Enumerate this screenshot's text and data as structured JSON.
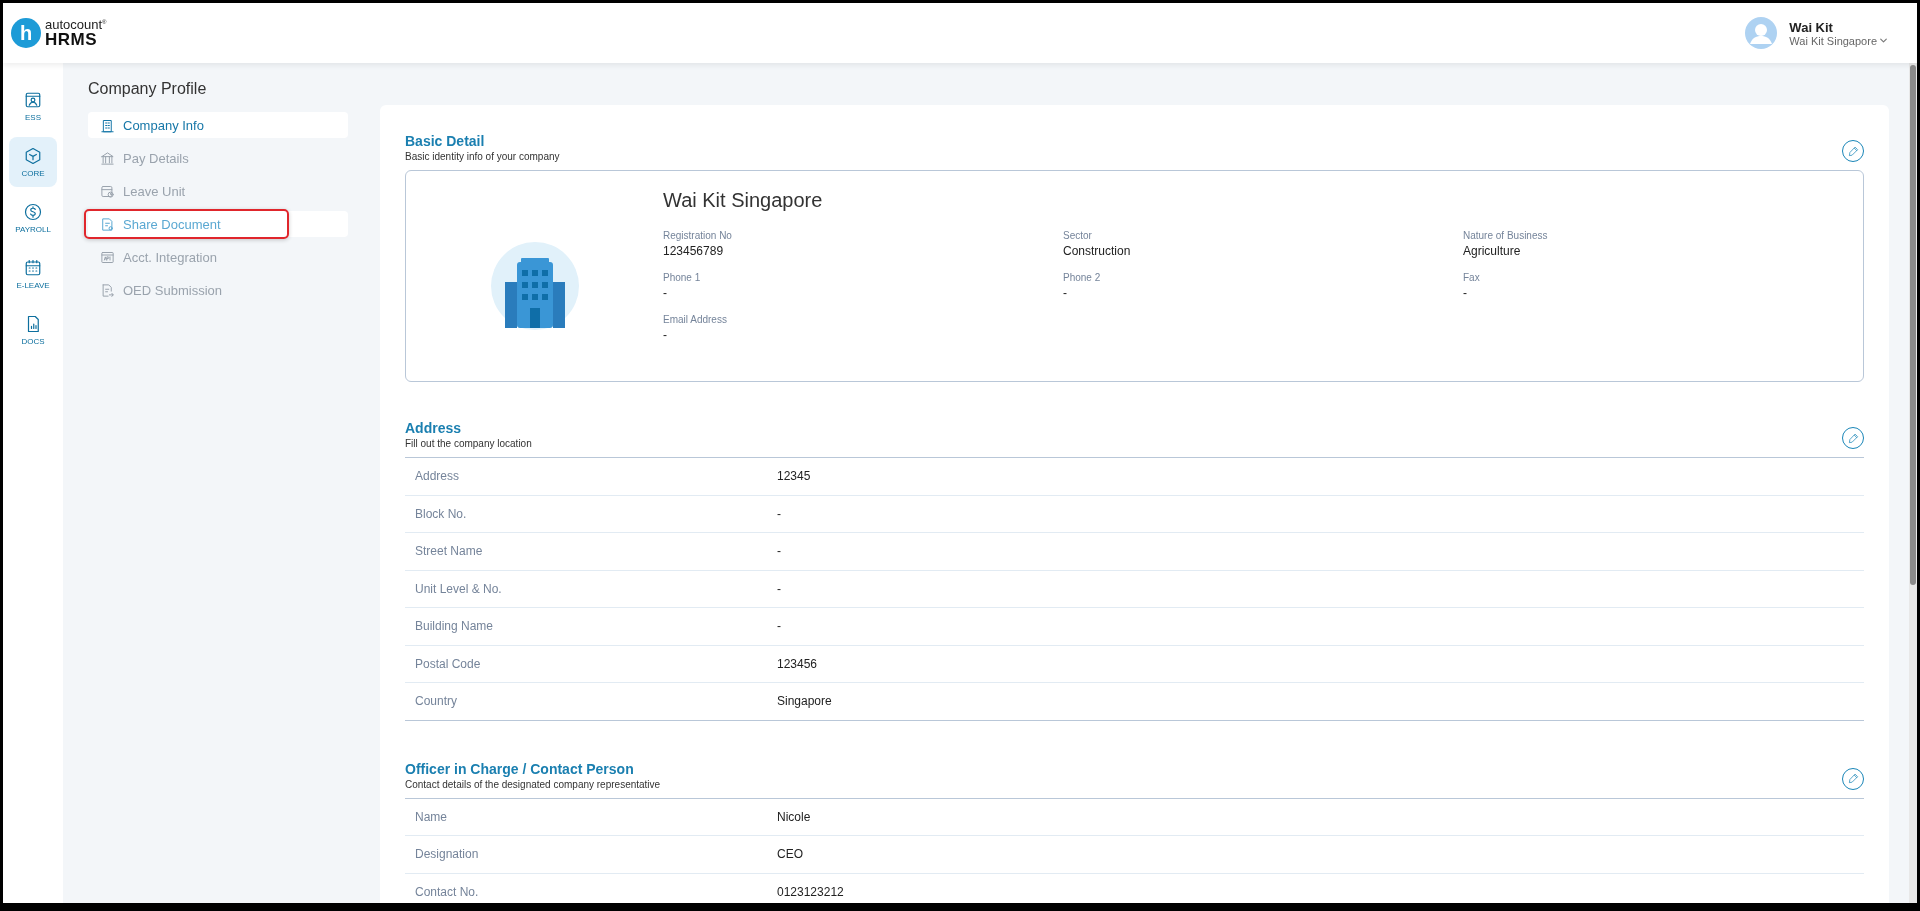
{
  "header": {
    "logo": {
      "mark": "h",
      "brand": "autocount$^{®}$",
      "product": "HRMS"
    },
    "user": {
      "name": "Wai Kit",
      "company": "Wai Kit Singapore"
    }
  },
  "rail": [
    {
      "label": "ESS",
      "kind": "ess",
      "selected": false
    },
    {
      "label": "CORE",
      "kind": "core",
      "selected": true
    },
    {
      "label": "PAYROLL",
      "kind": "payroll",
      "selected": false
    },
    {
      "label": "E-LEAVE",
      "kind": "leave",
      "selected": false
    },
    {
      "label": "DOCS",
      "kind": "docs",
      "selected": false
    }
  ],
  "page_title": "Company Profile",
  "nav": [
    {
      "label": "Company Info",
      "kind": "building",
      "selected": true,
      "highlighted": false
    },
    {
      "label": "Pay Details",
      "kind": "bank",
      "selected": false,
      "highlighted": false
    },
    {
      "label": "Leave Unit",
      "kind": "calendar",
      "selected": false,
      "highlighted": false
    },
    {
      "label": "Share Document",
      "kind": "document",
      "selected": false,
      "highlighted": true
    },
    {
      "label": "Acct. Integration",
      "kind": "api",
      "selected": false,
      "highlighted": false
    },
    {
      "label": "OED Submission",
      "kind": "submit",
      "selected": false,
      "highlighted": false
    }
  ],
  "basic_detail": {
    "title": "Basic Detail",
    "subtitle": "Basic identity info of your company",
    "company_name": "Wai Kit Singapore",
    "fields": [
      {
        "label": "Registration No",
        "value": "123456789"
      },
      {
        "label": "Sector",
        "value": "Construction"
      },
      {
        "label": "Nature of Business",
        "value": "Agriculture"
      },
      {
        "label": "Phone 1",
        "value": "-"
      },
      {
        "label": "Phone 2",
        "value": "-"
      },
      {
        "label": "Fax",
        "value": "-"
      },
      {
        "label": "Email Address",
        "value": "-"
      }
    ]
  },
  "address": {
    "title": "Address",
    "subtitle": "Fill out the company location",
    "rows": [
      {
        "label": "Address",
        "value": "12345"
      },
      {
        "label": "Block No.",
        "value": "-"
      },
      {
        "label": "Street Name",
        "value": "-"
      },
      {
        "label": "Unit Level & No.",
        "value": "-"
      },
      {
        "label": "Building Name",
        "value": "-"
      },
      {
        "label": "Postal Code",
        "value": "123456"
      },
      {
        "label": "Country",
        "value": "Singapore"
      }
    ]
  },
  "officer": {
    "title": "Officer in Charge / Contact Person",
    "subtitle": "Contact details of the designated company representative",
    "rows": [
      {
        "label": "Name",
        "value": "Nicole"
      },
      {
        "label": "Designation",
        "value": "CEO"
      },
      {
        "label": "Contact No.",
        "value": "0123123212"
      }
    ]
  }
}
